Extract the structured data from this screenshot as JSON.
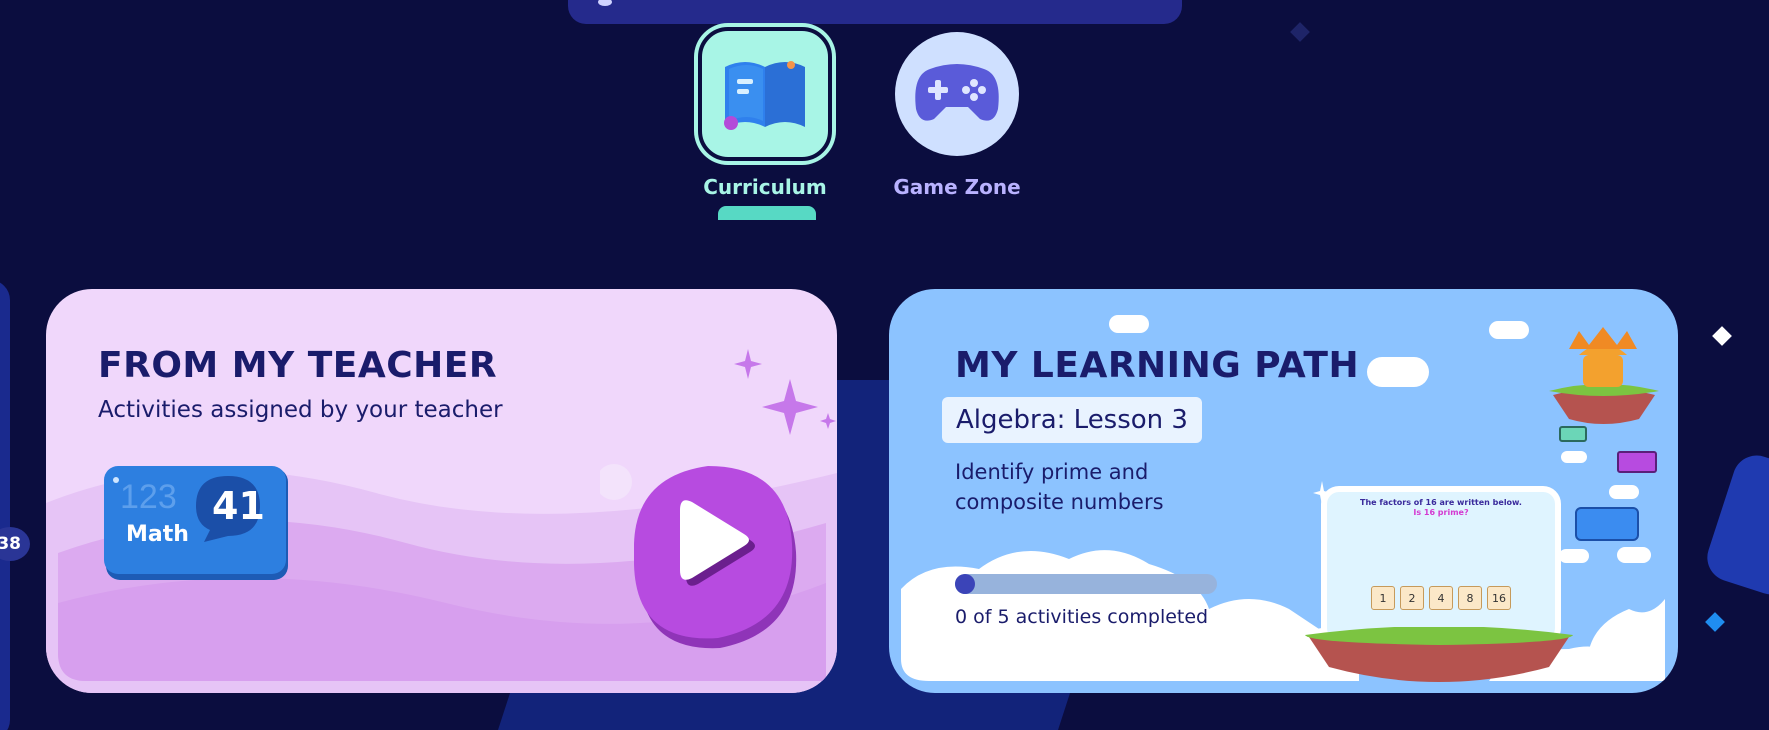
{
  "nav": {
    "items": [
      {
        "label": "Curriculum",
        "active": true
      },
      {
        "label": "Game Zone",
        "active": false
      }
    ]
  },
  "side_badge": "38",
  "teacher_card": {
    "title": "FROM MY TEACHER",
    "subtitle": "Activities assigned by your teacher",
    "badge_subject": "Math",
    "badge_count": "41",
    "badge_digits": "123"
  },
  "path_card": {
    "title": "MY LEARNING PATH",
    "lesson": "Algebra: Lesson 3",
    "description": "Identify prime and composite numbers",
    "progress_text": "0 of 5 activities completed",
    "progress_fraction": 0.05,
    "preview": {
      "line1": "The factors of 16 are written below.",
      "line2": "Is 16 prime?",
      "numbers": [
        "1",
        "2",
        "4",
        "8",
        "16"
      ]
    }
  },
  "colors": {
    "background": "#0b0d3f",
    "teacher_card": "#f0d7fb",
    "path_card": "#8cc3ff",
    "accent_teal": "#a8f5e6",
    "play_purple": "#b74be0"
  }
}
